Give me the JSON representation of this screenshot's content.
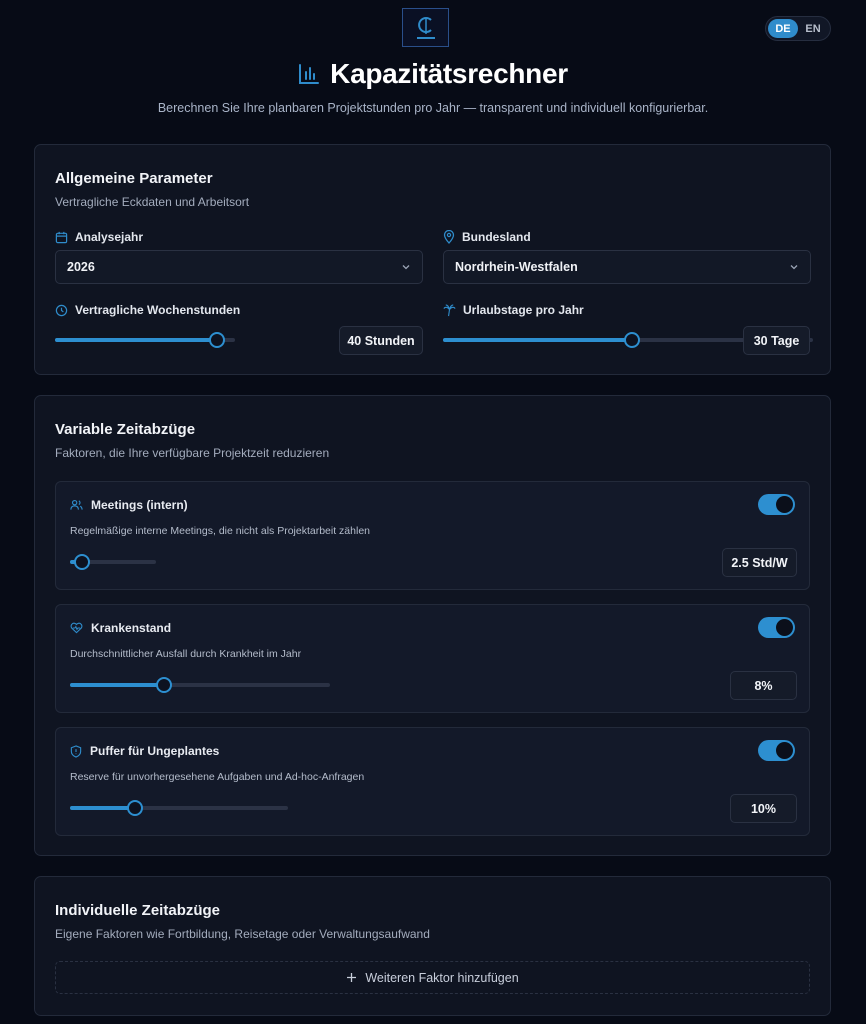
{
  "language": {
    "options": [
      "DE",
      "EN"
    ],
    "active": "DE"
  },
  "header": {
    "title": "Kapazitätsrechner",
    "subtitle": "Berechnen Sie Ihre planbaren Projektstunden pro Jahr — transparent und individuell konfigurierbar."
  },
  "general": {
    "title": "Allgemeine Parameter",
    "description": "Vertragliche Eckdaten und Arbeitsort",
    "year": {
      "label": "Analysejahr",
      "value": "2026",
      "icon": "calendar-icon"
    },
    "state": {
      "label": "Bundesland",
      "value": "Nordrhein-Westfalen",
      "icon": "map-pin-icon"
    },
    "weekly_hours": {
      "label": "Vertragliche Wochenstunden",
      "value_label": "40 Stunden",
      "fill": 0.9,
      "icon": "clock-icon"
    },
    "vacation": {
      "label": "Urlaubstage pro Jahr",
      "value_label": "30 Tage",
      "fill": 0.51,
      "icon": "palm-tree-icon"
    }
  },
  "variable": {
    "title": "Variable Zeitabzüge",
    "description": "Faktoren, die Ihre verfügbare Projektzeit reduzieren",
    "factors": [
      {
        "title": "Meetings (intern)",
        "description": "Regelmäßige interne Meetings, die nicht als Projektarbeit zählen",
        "value_label": "2.5 Std/W",
        "fill": 0.135,
        "enabled": true,
        "icon": "users-icon"
      },
      {
        "title": "Krankenstand",
        "description": "Durchschnittlicher Ausfall durch Krankheit im Jahr",
        "value_label": "8%",
        "fill": 0.36,
        "enabled": true,
        "icon": "heart-pulse-icon"
      },
      {
        "title": "Puffer für Ungeplantes",
        "description": "Reserve für unvorhergesehene Aufgaben und Ad-hoc-Anfragen",
        "value_label": "10%",
        "fill": 0.3,
        "enabled": true,
        "icon": "shield-icon"
      }
    ]
  },
  "custom": {
    "title": "Individuelle Zeitabzüge",
    "description": "Eigene Faktoren wie Fortbildung, Reisetage oder Verwaltungsaufwand",
    "add_label": "Weiteren Faktor hinzufügen"
  },
  "colors": {
    "accent": "#2d8fd0",
    "background": "#070b16",
    "card": "#0f1421"
  }
}
